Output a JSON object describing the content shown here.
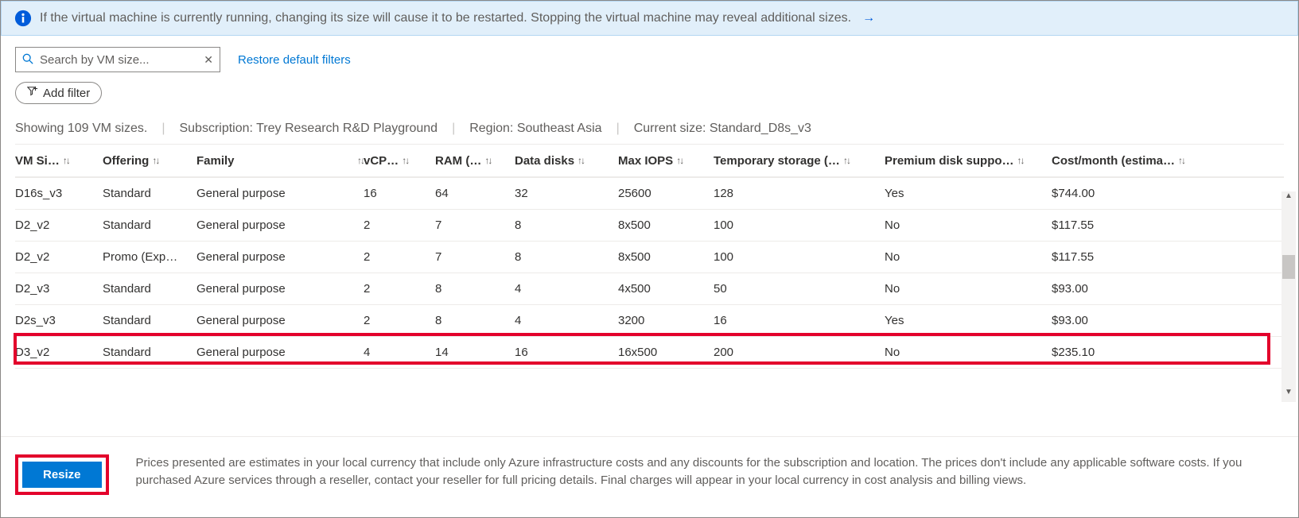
{
  "banner": {
    "text": "If the virtual machine is currently running, changing its size will cause it to be restarted. Stopping the virtual machine may reveal additional sizes.",
    "arrow": "→"
  },
  "search": {
    "placeholder": "Search by VM size...",
    "clear": "✕"
  },
  "links": {
    "restore": "Restore default filters"
  },
  "addFilter": "Add filter",
  "status": {
    "count": "Showing 109 VM sizes.",
    "sub": "Subscription: Trey Research R&D Playground",
    "region": "Region: Southeast Asia",
    "current": "Current size: Standard_D8s_v3"
  },
  "columns": [
    "VM Si…",
    "Offering",
    "Family",
    "vCP…",
    "RAM (…",
    "Data disks",
    "Max IOPS",
    "Temporary storage (…",
    "Premium disk suppo…",
    "Cost/month (estima…"
  ],
  "rows": [
    {
      "c": [
        "D16s_v3",
        "Standard",
        "General purpose",
        "16",
        "64",
        "32",
        "25600",
        "128",
        "Yes",
        "$744.00"
      ]
    },
    {
      "c": [
        "D2_v2",
        "Standard",
        "General purpose",
        "2",
        "7",
        "8",
        "8x500",
        "100",
        "No",
        "$117.55"
      ]
    },
    {
      "c": [
        "D2_v2",
        "Promo (Exp…",
        "General purpose",
        "2",
        "7",
        "8",
        "8x500",
        "100",
        "No",
        "$117.55"
      ]
    },
    {
      "c": [
        "D2_v3",
        "Standard",
        "General purpose",
        "2",
        "8",
        "4",
        "4x500",
        "50",
        "No",
        "$93.00"
      ]
    },
    {
      "c": [
        "D2s_v3",
        "Standard",
        "General purpose",
        "2",
        "8",
        "4",
        "3200",
        "16",
        "Yes",
        "$93.00"
      ],
      "hl": true
    },
    {
      "c": [
        "D3_v2",
        "Standard",
        "General purpose",
        "4",
        "14",
        "16",
        "16x500",
        "200",
        "No",
        "$235.10"
      ]
    }
  ],
  "resizeBtn": "Resize",
  "disclaimer": "Prices presented are estimates in your local currency that include only Azure infrastructure costs and any discounts for the subscription and location. The prices don't include any applicable software costs. If you purchased Azure services through a reseller, contact your reseller for full pricing details. Final charges will appear in your local currency in cost analysis and billing views."
}
